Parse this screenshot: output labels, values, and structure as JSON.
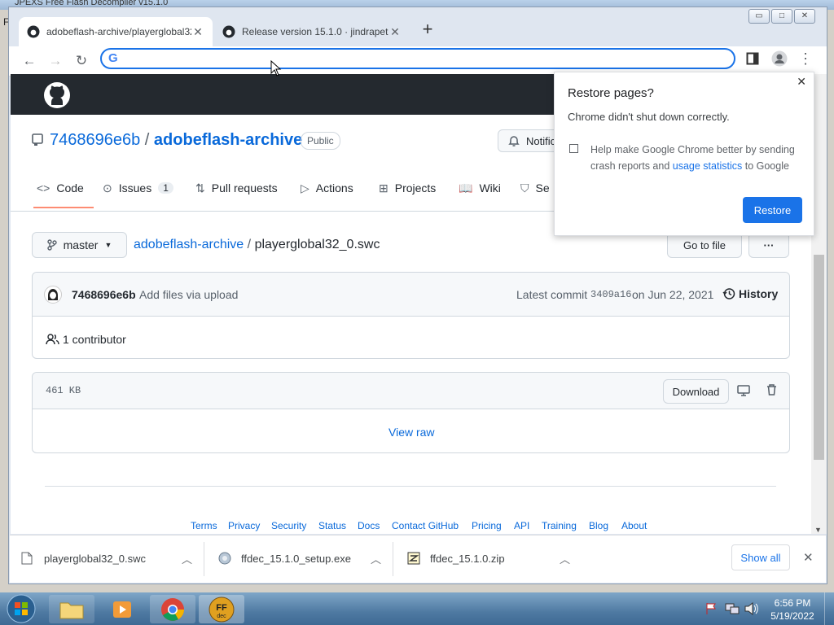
{
  "background_app": {
    "title": "JPEXS Free Flash Decompiler v15.1.0",
    "menu_letter": "F"
  },
  "window_controls": {
    "minimize": "▭",
    "maximize": "□",
    "close": "✕"
  },
  "tabs": [
    {
      "label": "adobeflash-archive/playerglobal32_0.swc",
      "close": "✕"
    },
    {
      "label": "Release version 15.1.0 · jindrapetrik",
      "close": "✕"
    }
  ],
  "new_tab": "+",
  "nav": {
    "back": "←",
    "forward": "→",
    "reload": "↻"
  },
  "omnibox": {
    "value": "",
    "icon": "G"
  },
  "github": {
    "repo_owner": "7468696e6b",
    "separator": "/",
    "repo_name": "adobeflash-archive",
    "visibility": "Public",
    "notifications": "Notifica",
    "tabs": [
      {
        "label": "Code",
        "icon": "<>"
      },
      {
        "label": "Issues",
        "count": "1",
        "icon": "⊙"
      },
      {
        "label": "Pull requests",
        "icon": "⇅"
      },
      {
        "label": "Actions",
        "icon": "▷"
      },
      {
        "label": "Projects",
        "icon": "⊞"
      },
      {
        "label": "Wiki",
        "icon": "📖"
      },
      {
        "label": "Se",
        "icon": "⛉"
      }
    ],
    "branch": "master",
    "breadcrumb": {
      "repo": "adobeflash-archive",
      "sep": "/",
      "file": "playerglobal32_0.swc"
    },
    "goto_file": "Go to file",
    "more": "···",
    "commit": {
      "author": "7468696e6b",
      "message": "Add files via upload",
      "latest_label": "Latest commit",
      "sha": "3409a16",
      "date": "on Jun 22, 2021",
      "history": "History"
    },
    "contributors": "1 contributor",
    "file_size": "461 KB",
    "download": "Download",
    "view_raw": "View raw",
    "footer": [
      "Terms",
      "Privacy",
      "Security",
      "Status",
      "Docs",
      "Contact GitHub",
      "Pricing",
      "API",
      "Training",
      "Blog",
      "About"
    ]
  },
  "popup": {
    "title": "Restore pages?",
    "message": "Chrome didn't shut down correctly.",
    "checkbox_text_1": "Help make Google Chrome better by sending",
    "checkbox_text_2": "crash reports and",
    "checkbox_link": "usage statistics",
    "checkbox_text_3": "to Google",
    "restore": "Restore",
    "close": "✕"
  },
  "downloads": [
    {
      "name": "playerglobal32_0.swc"
    },
    {
      "name": "ffdec_15.1.0_setup.exe"
    },
    {
      "name": "ffdec_15.1.0.zip"
    }
  ],
  "show_all": "Show all",
  "shelf_close": "✕",
  "tray": {
    "time": "6:56 PM",
    "date": "5/19/2022"
  },
  "colors": {
    "accent": "#1a73e8",
    "link": "#0969da",
    "header": "#24292f",
    "tab_underline": "#fd8c73"
  }
}
